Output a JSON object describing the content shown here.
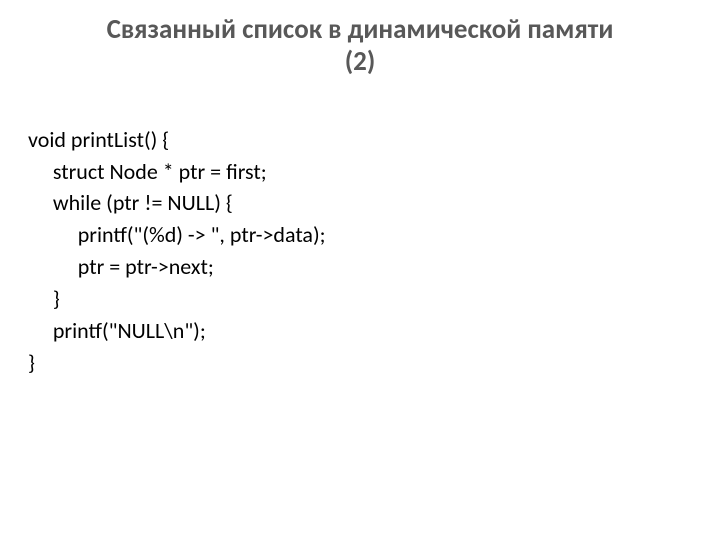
{
  "title_line1": "Связанный список в динамической памяти",
  "title_line2": "(2)",
  "code": {
    "l1": "void printList() {",
    "l2": "     struct Node * ptr = first;",
    "l3": "     while (ptr != NULL) {",
    "l4": "          printf(\"(%d) -> \", ptr->data);",
    "l5": "          ptr = ptr->next;",
    "l6": "     }",
    "l7": "     printf(\"NULL\\n\");",
    "l8": "}"
  }
}
